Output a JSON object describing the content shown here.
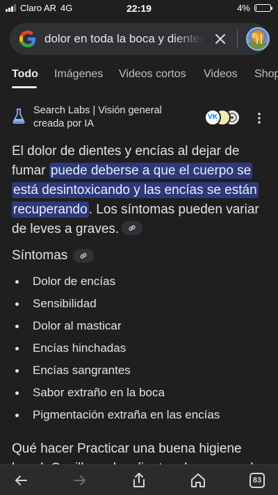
{
  "status_bar": {
    "carrier": "Claro AR",
    "network": "4G",
    "time": "22:19",
    "battery_text": "4%",
    "battery_level": 0.04
  },
  "search": {
    "query": "dolor en toda la boca y dientes al dejar de fumar",
    "clear_icon": "close-icon",
    "account_icon": "avatar"
  },
  "tabs": [
    {
      "label": "Todo",
      "active": true
    },
    {
      "label": "Imágenes"
    },
    {
      "label": "Videos cortos"
    },
    {
      "label": "Videos"
    },
    {
      "label": "Shopping"
    }
  ],
  "ai_overview": {
    "title_line1": "Search Labs | Visión general",
    "title_line2": "creada por IA",
    "source_badges": [
      "VK",
      "",
      ""
    ],
    "paragraph_before": "El dolor de dientes y encías al dejar de fumar ",
    "paragraph_highlight": "puede deberse a que el cuerpo se está desintoxicando y las encías se están recuperando",
    "paragraph_after": ". Los síntomas pueden variar de leves a graves.",
    "symptoms_heading": "Síntomas",
    "symptoms": [
      "Dolor de encías",
      "Sensibilidad",
      "Dolor al masticar",
      "Encías hinchadas",
      "Encías sangrantes",
      "Sabor extraño en la boca",
      "Pigmentación extraña en las encías"
    ],
    "next_paragraph": "Qué hacer Practicar una buena higiene bucal: Cepillarse los dientes dos veces al día"
  },
  "bottom_bar": {
    "tab_count": "83"
  },
  "colors": {
    "background": "#1f1f1f",
    "highlight": "#2e3a78",
    "search_bg": "#303134",
    "accent": "#8ab4f8"
  }
}
